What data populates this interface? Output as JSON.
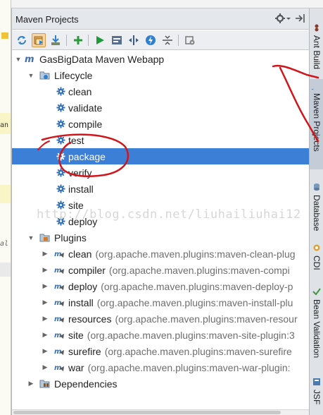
{
  "panel": {
    "title": "Maven Projects"
  },
  "toolbar": {
    "buttons": [
      {
        "icon": "refresh-icon"
      },
      {
        "icon": "generate-sources-icon"
      },
      {
        "icon": "download-icon"
      },
      {
        "icon": "add-icon"
      },
      {
        "icon": "run-icon"
      },
      {
        "icon": "execute-goal-icon"
      },
      {
        "icon": "toggle-offline-icon"
      },
      {
        "icon": "skip-tests-icon"
      },
      {
        "icon": "collapse-all-icon"
      },
      {
        "icon": "settings-icon"
      }
    ]
  },
  "tree": {
    "project": "GasBigData Maven Webapp",
    "lifecycle": {
      "label": "Lifecycle",
      "phases": [
        "clean",
        "validate",
        "compile",
        "test",
        "package",
        "verify",
        "install",
        "site",
        "deploy"
      ],
      "selected": "package"
    },
    "plugins": {
      "label": "Plugins",
      "items": [
        {
          "name": "clean",
          "artifact": "(org.apache.maven.plugins:maven-clean-plug"
        },
        {
          "name": "compiler",
          "artifact": "(org.apache.maven.plugins:maven-compi"
        },
        {
          "name": "deploy",
          "artifact": "(org.apache.maven.plugins:maven-deploy-p"
        },
        {
          "name": "install",
          "artifact": "(org.apache.maven.plugins:maven-install-plu"
        },
        {
          "name": "resources",
          "artifact": "(org.apache.maven.plugins:maven-resour"
        },
        {
          "name": "site",
          "artifact": "(org.apache.maven.plugins:maven-site-plugin:3"
        },
        {
          "name": "surefire",
          "artifact": "(org.apache.maven.plugins:maven-surefire"
        },
        {
          "name": "war",
          "artifact": "(org.apache.maven.plugins:maven-war-plugin:"
        }
      ]
    },
    "dependencies": {
      "label": "Dependencies"
    }
  },
  "right_tabs": [
    "Ant Build",
    "Maven Projects",
    "Database",
    "CDI",
    "Bean Validation",
    "JSF"
  ],
  "editor_fragments": [
    "an",
    "al"
  ],
  "watermark": "http://blog.csdn.net/liuhailiuhai12",
  "colors": {
    "selection": "#3c7fd6",
    "annotation": "#d0161b",
    "header": "#e4e7ec"
  }
}
